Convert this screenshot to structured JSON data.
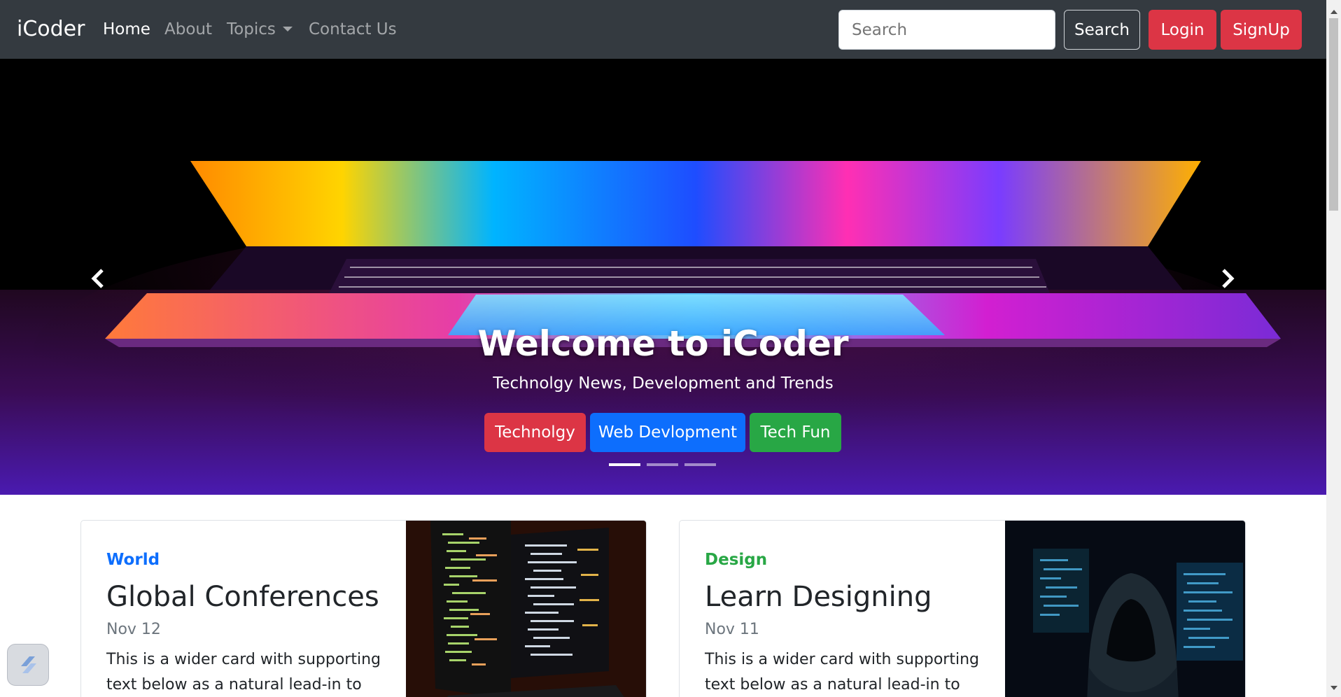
{
  "navbar": {
    "brand": "iCoder",
    "links": [
      {
        "label": "Home",
        "active": true
      },
      {
        "label": "About",
        "active": false
      },
      {
        "label": "Topics",
        "active": false,
        "dropdown": true
      },
      {
        "label": "Contact Us",
        "active": false
      }
    ],
    "search": {
      "placeholder": "Search",
      "button_label": "Search"
    },
    "login_label": "Login",
    "signup_label": "SignUp"
  },
  "carousel": {
    "title": "Welcome to iCoder",
    "subtitle": "Technolgy News, Development and Trends",
    "buttons": [
      {
        "label": "Technolgy",
        "color": "#dc3545"
      },
      {
        "label": "Web Devlopment",
        "color": "#0d6efd"
      },
      {
        "label": "Tech Fun",
        "color": "#28a745"
      }
    ],
    "slide_count": 3,
    "active_slide": 1,
    "prev_icon": "chevron-left-icon",
    "next_icon": "chevron-right-icon"
  },
  "cards": [
    {
      "category": "World",
      "category_color": "#0d6efd",
      "title": "Global Conferences",
      "date": "Nov 12",
      "text": "This is a wider card with supporting text below as a natural lead-in to",
      "image": "code-monitors-image"
    },
    {
      "category": "Design",
      "category_color": "#28a745",
      "title": "Learn Designing",
      "date": "Nov 11",
      "text": "This is a wider card with supporting text below as a natural lead-in to",
      "image": "hooded-hacker-image"
    }
  ],
  "colors": {
    "navbar_bg": "#343a40",
    "danger": "#dc3545",
    "primary": "#0d6efd",
    "success": "#28a745"
  }
}
